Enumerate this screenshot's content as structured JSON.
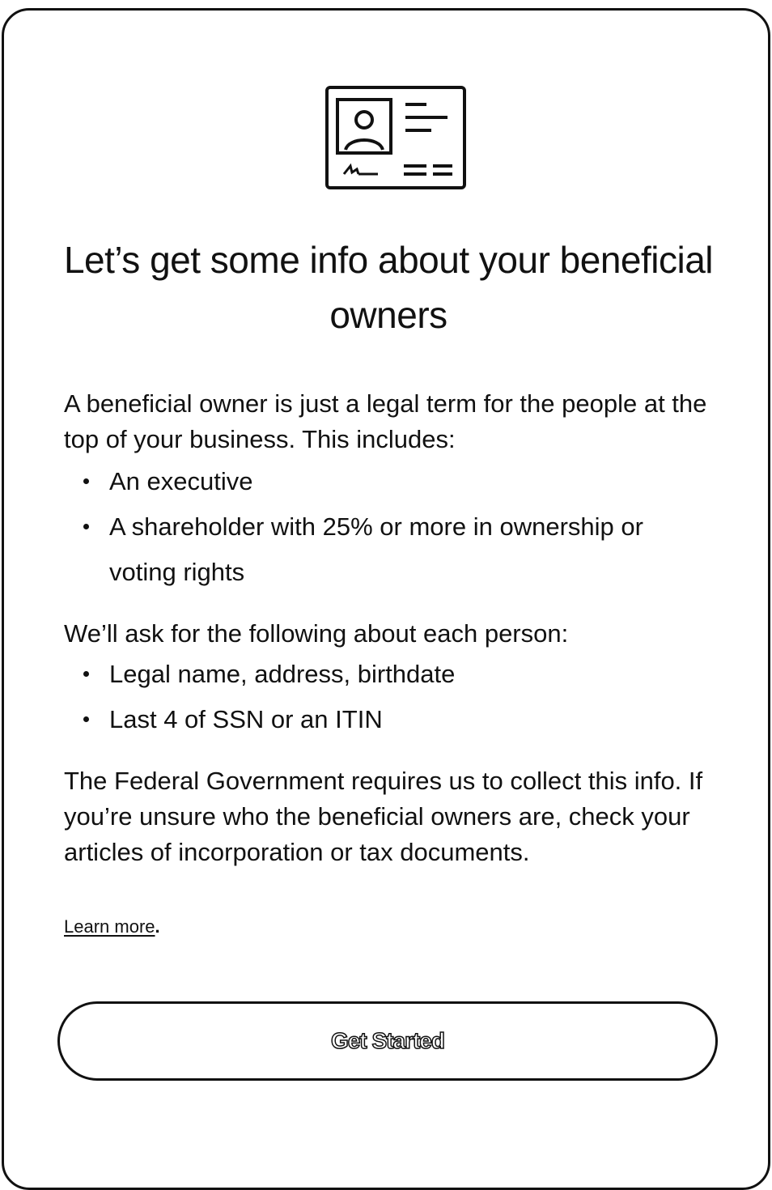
{
  "header": {
    "icon": "id-card-icon",
    "title": "Let’s get some info about your beneficial owners"
  },
  "intro": {
    "text": "A beneficial owner is just a legal term for the people at the top of your business. This includes:",
    "items": [
      "An executive",
      "A shareholder with 25% or more in ownership or voting rights"
    ]
  },
  "ask": {
    "text": "We’ll ask for the following about each person:",
    "items": [
      "Legal name, address, birthdate",
      "Last 4 of SSN or an ITIN"
    ]
  },
  "federal": {
    "text": "The Federal Government requires us to collect this info. If you’re unsure who the beneficial owners are, check your articles of incorporation or tax documents."
  },
  "learn_more": {
    "label": "Learn more",
    "suffix": "."
  },
  "cta": {
    "label": "Get Started"
  }
}
